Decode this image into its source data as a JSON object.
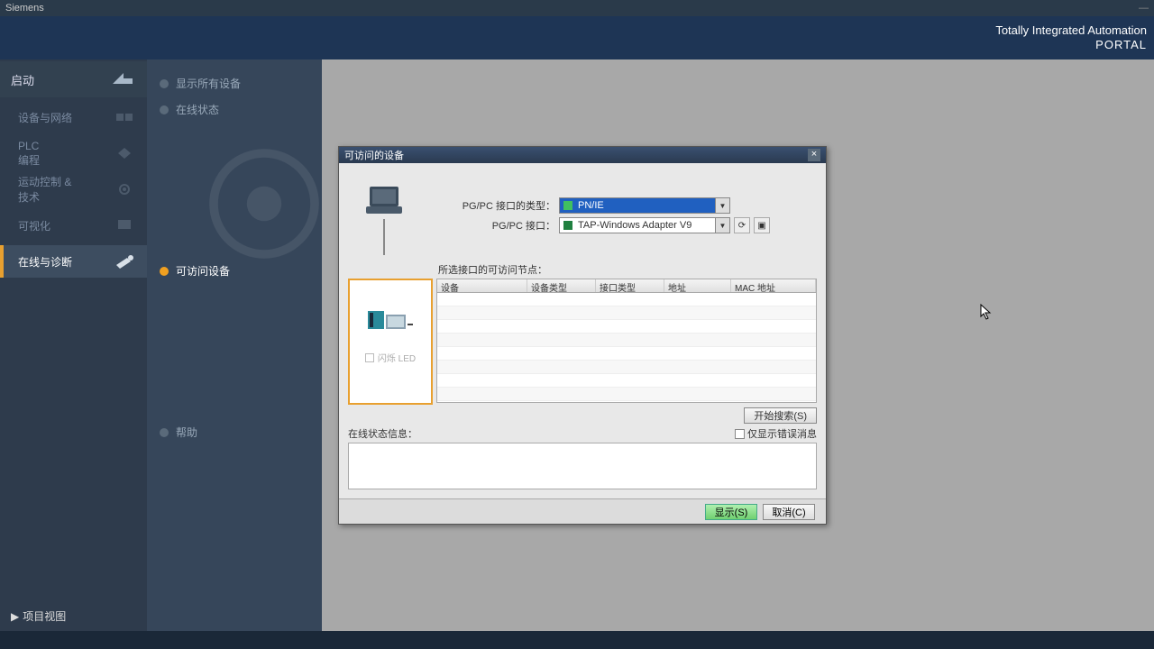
{
  "titlebar": {
    "app": "Siemens"
  },
  "brand": {
    "line1": "Totally Integrated Automation",
    "line2": "PORTAL"
  },
  "left": {
    "start": "启动",
    "items": [
      {
        "label": "设备与网络"
      },
      {
        "label": "PLC\n编程"
      },
      {
        "label": "运动控制 &\n技术"
      },
      {
        "label": "可视化"
      },
      {
        "label": "在线与诊断"
      }
    ],
    "project_view": "项目视图"
  },
  "mid": {
    "items": [
      {
        "label": "显示所有设备"
      },
      {
        "label": "在线状态"
      },
      {
        "label": "可访问设备"
      },
      {
        "label": "帮助"
      }
    ]
  },
  "dialog": {
    "title": "可访问的设备",
    "cfg1_label": "PG/PC 接口的类型：",
    "cfg1_value": "PN/IE",
    "cfg2_label": "PG/PC 接口：",
    "cfg2_value": "TAP-Windows Adapter V9",
    "nodes_label": "所选接口的可访问节点：",
    "columns": {
      "c1": "设备",
      "c2": "设备类型",
      "c3": "接口类型",
      "c4": "地址",
      "c5": "MAC 地址"
    },
    "flash_led": "闪烁 LED",
    "search_btn": "开始搜索(S)",
    "status_label": "在线状态信息：",
    "errors_only": "仅显示错误消息",
    "show_btn": "显示(S)",
    "cancel_btn": "取消(C)"
  }
}
